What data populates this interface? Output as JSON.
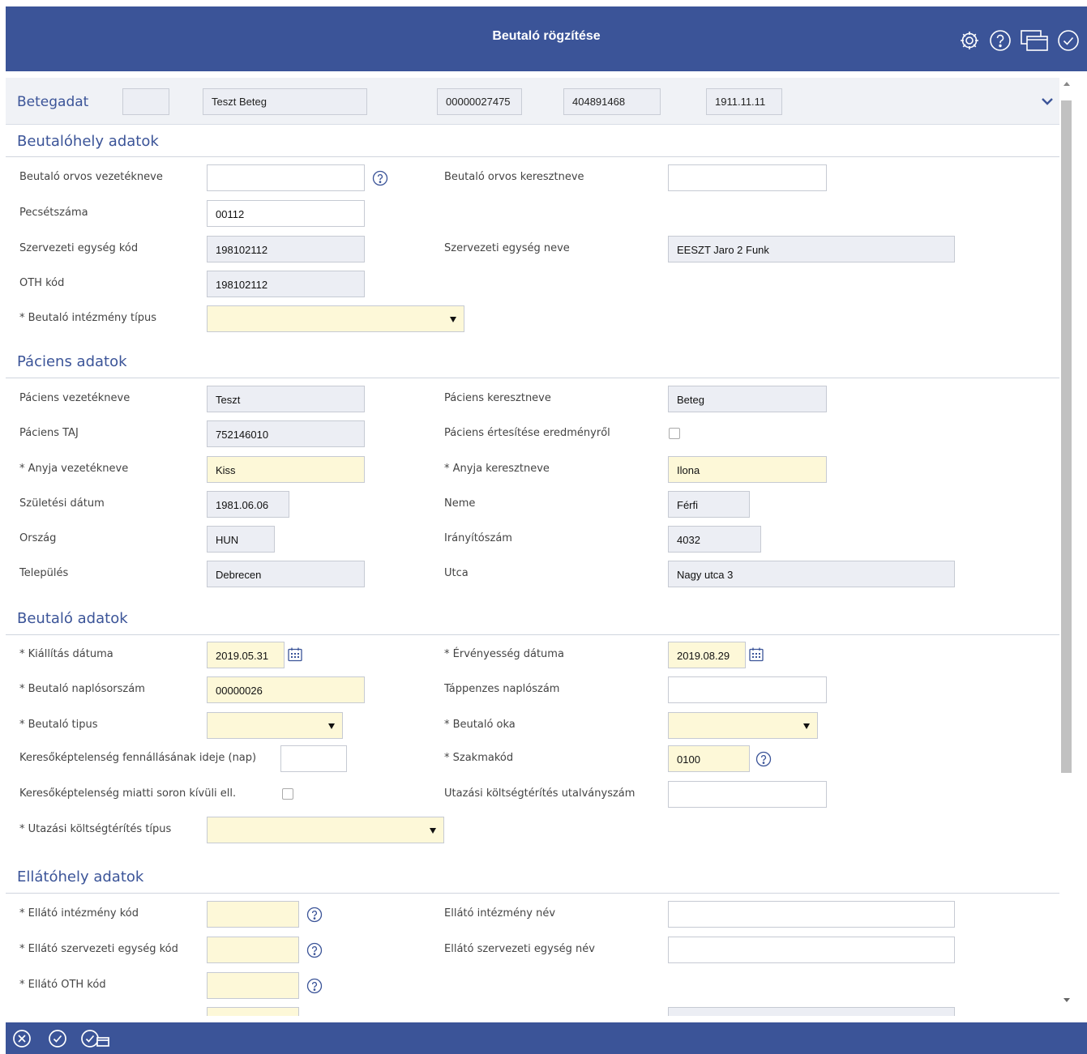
{
  "header": {
    "title": "Beutaló rögzítése"
  },
  "patient_bar": {
    "title": "Betegadat",
    "box_empty": "",
    "name": "Teszt Beteg",
    "id": "00000027475",
    "taj": "404891468",
    "date": "1911.11.11"
  },
  "sections": {
    "beutalohely": "Beutalóhely adatok",
    "paciens": "Páciens adatok",
    "beutalo": "Beutaló adatok",
    "ellatohely": "Ellátóhely adatok"
  },
  "beutalohely": {
    "orvos_vezeteknev_label": "Beutaló orvos vezetékneve",
    "orvos_vezeteknev": "",
    "orvos_keresztnev_label": "Beutaló orvos keresztneve",
    "orvos_keresztnev": "",
    "pecsetszam_label": "Pecsétszáma",
    "pecsetszam": "00112",
    "szerv_kod_label": "Szervezeti egység kód",
    "szerv_kod": "198102112",
    "szerv_nev_label": "Szervezeti egység neve",
    "szerv_nev": "EESZT Jaro 2 Funk",
    "oth_label": "OTH kód",
    "oth": "198102112",
    "intezmeny_tipus_label": "* Beutaló intézmény típus",
    "intezmeny_tipus": ""
  },
  "paciens": {
    "vezeteknev_label": "Páciens vezetékneve",
    "vezeteknev": "Teszt",
    "keresztnev_label": "Páciens keresztneve",
    "keresztnev": "Beteg",
    "taj_label": "Páciens TAJ",
    "taj": "752146010",
    "ertesites_label": "Páciens értesítése eredményről",
    "anyja_vezeteknev_label": "* Anyja vezetékneve",
    "anyja_vezeteknev": "Kiss",
    "anyja_keresztnev_label": "* Anyja keresztneve",
    "anyja_keresztnev": "Ilona",
    "szuletesi_label": "Születési dátum",
    "szuletesi": "1981.06.06",
    "neme_label": "Neme",
    "neme": "Férfi",
    "orszag_label": "Ország",
    "orszag": "HUN",
    "iranyitoszam_label": "Irányítószám",
    "iranyitoszam": "4032",
    "telepules_label": "Település",
    "telepules": "Debrecen",
    "utca_label": "Utca",
    "utca": "Nagy utca 3"
  },
  "beutalo": {
    "kiallitas_label": "* Kiállítás dátuma",
    "kiallitas": "2019.05.31",
    "ervenyesseg_label": "* Érvényesség dátuma",
    "ervenyesseg": "2019.08.29",
    "naplosorszam_label": "* Beutaló naplósorszám",
    "naplosorszam": "00000026",
    "tappenzes_label": "Táppenzes naplószám",
    "tappenzes": "",
    "tipus_label": "* Beutaló tipus",
    "tipus": "",
    "oka_label": "* Beutaló oka",
    "oka": "",
    "keresokeptelenseg_ideje_label": "Keresőképtelenség fennállásának ideje (nap)",
    "keresokeptelenseg_ideje": "",
    "szakmakod_label": "* Szakmakód",
    "szakmakod": "0100",
    "soron_kivuli_label": "Keresőképtelenség miatti soron kívüli ell.",
    "utazasi_utalvany_label": "Utazási költségtérítés utalványszám",
    "utazasi_utalvany": "",
    "utazasi_tipus_label": "* Utazási költségtérítés típus",
    "utazasi_tipus": ""
  },
  "ellatohely": {
    "intezmeny_kod_label": "* Ellátó intézmény kód",
    "intezmeny_kod": "",
    "intezmeny_nev_label": "Ellátó intézmény név",
    "intezmeny_nev": "",
    "szerv_kod_label": "* Ellátó szervezeti egység kód",
    "szerv_kod": "",
    "szerv_nev_label": "Ellátó szervezeti egység név",
    "szerv_nev": "",
    "oth_label": "* Ellátó OTH kód",
    "oth": ""
  },
  "colors": {
    "accent": "#3b5498",
    "required": "#fdf8d8",
    "readonly": "#eceef4"
  },
  "icons": [
    "settings-icon",
    "help-icon",
    "windows-icon",
    "check-circle-icon",
    "chevron-down-icon",
    "calendar-icon",
    "cancel-icon",
    "save-icon",
    "save-and-close-icon"
  ]
}
